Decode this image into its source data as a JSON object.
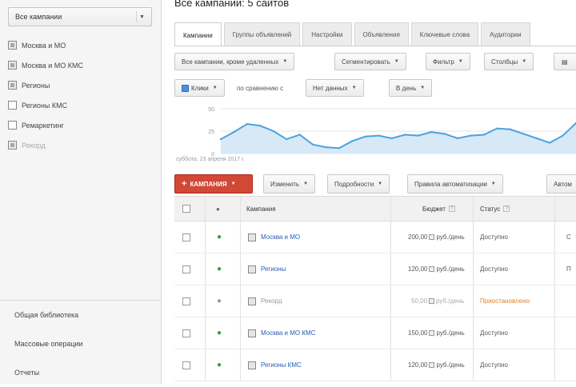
{
  "sidebar": {
    "select_label": "Все кампании",
    "items": [
      {
        "label": "Москва и МО",
        "checked": true,
        "disabled": false
      },
      {
        "label": "Москва и МО КМС",
        "checked": true,
        "disabled": false
      },
      {
        "label": "Регионы",
        "checked": true,
        "disabled": false
      },
      {
        "label": "Регионы КМС",
        "checked": false,
        "disabled": false
      },
      {
        "label": "Ремаркетинг",
        "checked": false,
        "disabled": false
      },
      {
        "label": "Рекорд",
        "checked": true,
        "disabled": true
      }
    ],
    "bottom_links": [
      "Общая библиотека",
      "Массовые операции",
      "Отчеты"
    ]
  },
  "header": {
    "title": "Все кампании: 5 сайтов"
  },
  "tabs": [
    "Кампании",
    "Группы объявлений",
    "Настройки",
    "Объявления",
    "Ключевые слова",
    "Аудитории"
  ],
  "toolbar": {
    "filter_label": "Все кампании, кроме удаленных",
    "segment_label": "Сегментировать",
    "filter2_label": "Фильтр",
    "columns_label": "Столбцы"
  },
  "chart_controls": {
    "metric_label": "Клики",
    "compare_text": "по сравнению с",
    "period_label": "Нет данных",
    "granularity_label": "В день"
  },
  "chart_caption": "суббота, 23 апреля 2017 г.",
  "chart_data": {
    "type": "area",
    "series": [
      {
        "values": [
          16,
          24,
          33,
          31,
          25,
          16,
          21,
          10,
          7,
          6,
          14,
          19,
          20,
          17,
          21,
          20,
          24,
          22,
          17,
          20,
          21,
          28,
          27,
          22,
          17,
          12,
          20,
          34
        ]
      }
    ],
    "ylim": [
      0,
      50
    ],
    "y_ticks": [
      "50",
      "25",
      "0"
    ]
  },
  "actions": {
    "add_campaign_label": "КАМПАНИЯ",
    "edit_label": "Изменить",
    "details_label": "Подробности",
    "auto_rules_label": "Правила автоматизации",
    "more_label": "Автом"
  },
  "table": {
    "columns": {
      "campaign": "Кампания",
      "budget": "Бюджет",
      "status": "Статус"
    },
    "rows": [
      {
        "campaign": "Москва и МО",
        "budget": "200,00",
        "status": "Доступно",
        "muted": false,
        "paused": false,
        "tail": "С"
      },
      {
        "campaign": "Регионы",
        "budget": "120,00",
        "status": "Доступно",
        "muted": false,
        "paused": false,
        "tail": "П"
      },
      {
        "campaign": "Рекорд",
        "budget": "50,00",
        "status": "Приостановлено",
        "muted": true,
        "paused": true,
        "tail": ""
      },
      {
        "campaign": "Москва и МО КМС",
        "budget": "150,00",
        "status": "Доступно",
        "muted": false,
        "paused": false,
        "tail": ""
      },
      {
        "campaign": "Регионы КМС",
        "budget": "120,00",
        "status": "Доступно",
        "muted": false,
        "paused": false,
        "tail": ""
      }
    ],
    "unit": "руб./день"
  }
}
